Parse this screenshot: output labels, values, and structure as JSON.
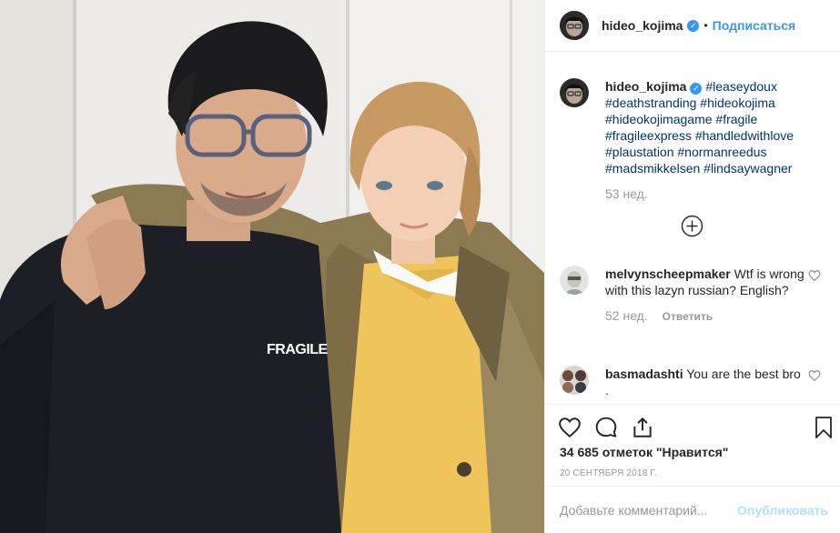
{
  "post": {
    "username": "hideo_kojima",
    "verified_mark": "✓",
    "separator": "•",
    "follow_label": "Подписаться",
    "photo_shirt_text": "FRAGILE"
  },
  "caption": {
    "username": "hideo_kojima",
    "hashtags_text": " #leaseydoux #deathstranding #hideokojima #hideokojimagame #fragile #fragileexpress #handledwithlove #plaustation #normanreedus #madsmikkelsen #lindsaywagner",
    "time": "53 нед."
  },
  "comments": [
    {
      "username": "melvynscheepmaker",
      "text": " Wtf is wrong with this lazyn russian? English?",
      "time": "52 нед.",
      "reply_label": "Ответить"
    },
    {
      "username": "basmadashti",
      "text": " You are the best bro ."
    }
  ],
  "actions": {
    "likes": "34 685 отметок \"Нравится\"",
    "date": "20 СЕНТЯБРЯ 2018 Г."
  },
  "comment_box": {
    "placeholder": "Добавьте комментарий...",
    "post_label": "Опубликовать"
  },
  "icons": [
    "heart-icon",
    "comment-icon",
    "share-icon",
    "bookmark-icon",
    "add-circle-icon",
    "small-heart-icon"
  ],
  "colors": {
    "accent": "#3897f0",
    "hashtag": "#003569",
    "muted": "#999999",
    "border": "#efefef"
  }
}
